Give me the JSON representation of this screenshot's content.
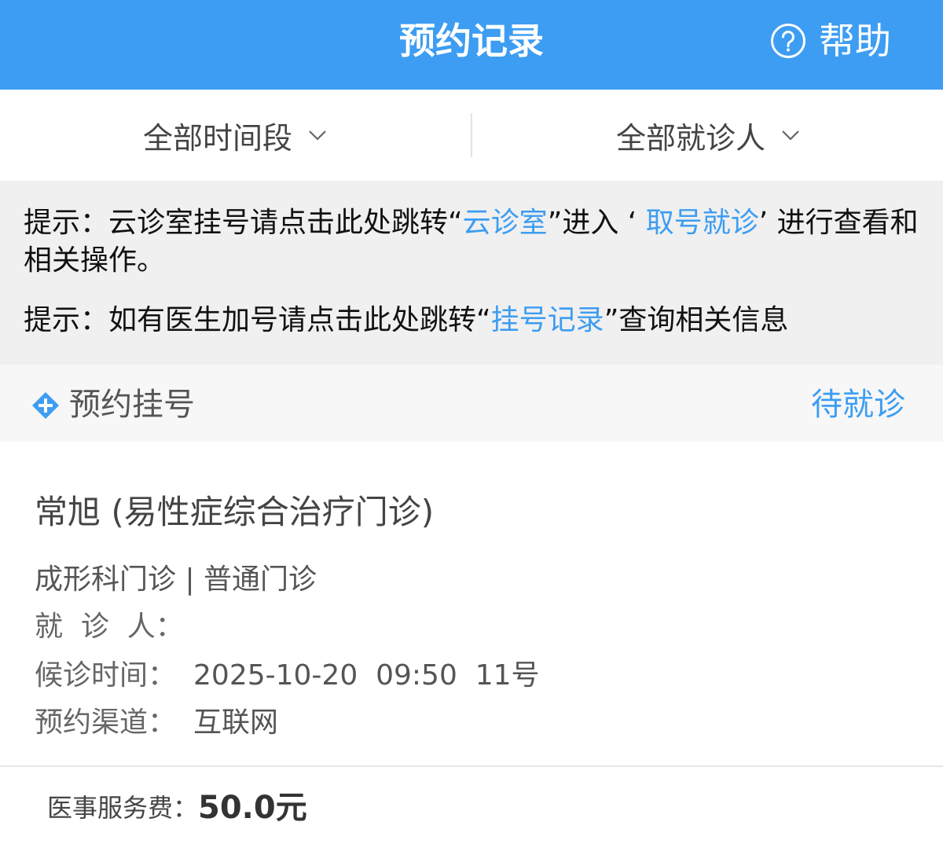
{
  "header": {
    "title": "预约记录",
    "help_label": "帮助",
    "help_icon": "question-circle-icon"
  },
  "filters": {
    "time_label": "全部时间段",
    "patient_label": "全部就诊人"
  },
  "notice": {
    "line1_prefix": "提示：云诊室挂号请点击此处跳转",
    "line1_quote_open": "“",
    "line1_link1": "云诊室",
    "line1_quote_close": "”",
    "line1_mid": "进入 ‘ ",
    "line1_link2": "取号就诊",
    "line1_suffix": "’ 进行查看和相关操作。",
    "line2_prefix": "提示：如有医生加号请点击此处跳转",
    "line2_quote_open": "“",
    "line2_link": "挂号记录",
    "line2_quote_close": "”",
    "line2_suffix": "查询相关信息"
  },
  "section": {
    "icon": "plus-circle-icon",
    "title": "预约挂号",
    "status": "待就诊"
  },
  "appointment": {
    "doctor": "常旭 (易性症综合治疗门诊)",
    "department": "成形科门诊 | 普通门诊",
    "patient_label": "就  诊  人：",
    "patient_value": "",
    "time_label": "候诊时间：",
    "time_value": "2025-10-20  09:50  11号",
    "channel_label": "预约渠道：",
    "channel_value": "互联网"
  },
  "fee": {
    "label": "医事服务费：",
    "value": "50.0元"
  },
  "colors": {
    "accent": "#3d9df2",
    "notice_bg": "#f0f0f0"
  }
}
